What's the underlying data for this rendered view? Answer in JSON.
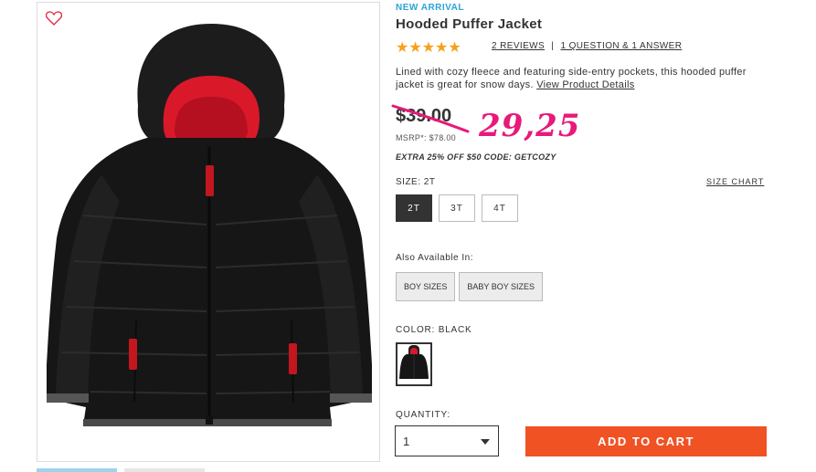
{
  "product": {
    "badge": "NEW ARRIVAL",
    "title": "Hooded Puffer Jacket",
    "rating_stars": "★★★★★",
    "reviews_link": "2 REVIEWS",
    "qa_link": "1 QUESTION & 1 ANSWER",
    "separator": "|",
    "description": "Lined with cozy fleece and featuring side-entry pockets, this hooded puffer jacket is great for snow days.",
    "view_details": "View Product Details",
    "image_icon": "jacket-image",
    "favorite_icon": "heart-icon"
  },
  "pricing": {
    "old_price": "$39.00",
    "new_price": "29,25",
    "msrp": "MSRP*: $78.00",
    "promo": "EXTRA 25% OFF $50 CODE: GETCOZY"
  },
  "size": {
    "label": "SIZE: 2T",
    "chart_link": "SIZE CHART",
    "options": [
      "2T",
      "3T",
      "4T"
    ],
    "selected": "2T"
  },
  "also_available": {
    "label": "Also Available In:",
    "options": [
      "BOY SIZES",
      "BABY BOY SIZES"
    ]
  },
  "color": {
    "label": "COLOR: BLACK"
  },
  "quantity": {
    "label": "QUANTITY:",
    "value": "1"
  },
  "cart": {
    "button_label": "ADD TO CART"
  },
  "colors": {
    "accent_blue": "#2aa5d6",
    "star_orange": "#f5a11c",
    "price_pink": "#e8197a",
    "cart_orange": "#f05223"
  }
}
